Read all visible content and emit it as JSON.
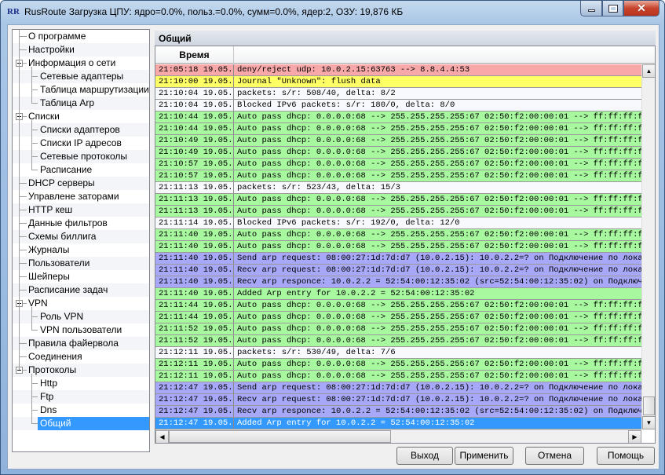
{
  "window": {
    "icon_text": "RR",
    "title": "RusRoute   Загрузка ЦПУ: ядро=0.0%, польз.=0.0%, сумм=0.0%, ядер:2,  ОЗУ: 19,876 КБ"
  },
  "tree": [
    {
      "label": "О программе",
      "level": 0
    },
    {
      "label": "Настройки",
      "level": 0
    },
    {
      "label": "Информация о сети",
      "level": 0,
      "expanded": true
    },
    {
      "label": "Сетевые адаптеры",
      "level": 1
    },
    {
      "label": "Таблица маршрутизации",
      "level": 1
    },
    {
      "label": "Таблица Arp",
      "level": 1,
      "last": true
    },
    {
      "label": "Списки",
      "level": 0,
      "expanded": true
    },
    {
      "label": "Списки адаптеров",
      "level": 1
    },
    {
      "label": "Списки IP адресов",
      "level": 1
    },
    {
      "label": "Сетевые протоколы",
      "level": 1
    },
    {
      "label": "Расписание",
      "level": 1,
      "last": true
    },
    {
      "label": "DHCP серверы",
      "level": 0
    },
    {
      "label": "Управлене заторами",
      "level": 0
    },
    {
      "label": "HTTP кеш",
      "level": 0
    },
    {
      "label": "Данные фильтров",
      "level": 0
    },
    {
      "label": "Схемы биллига",
      "level": 0
    },
    {
      "label": "Журналы",
      "level": 0
    },
    {
      "label": "Пользователи",
      "level": 0
    },
    {
      "label": "Шейперы",
      "level": 0
    },
    {
      "label": "Расписание задач",
      "level": 0
    },
    {
      "label": "VPN",
      "level": 0,
      "expanded": true
    },
    {
      "label": "Роль VPN",
      "level": 1
    },
    {
      "label": "VPN пользователи",
      "level": 1,
      "last": true
    },
    {
      "label": "Правила файервола",
      "level": 0
    },
    {
      "label": "Соединения",
      "level": 0
    },
    {
      "label": "Протоколы",
      "level": 0,
      "expanded": true,
      "last": true
    },
    {
      "label": "Http",
      "level": 1
    },
    {
      "label": "Ftp",
      "level": 1
    },
    {
      "label": "Dns",
      "level": 1
    },
    {
      "label": "Общий",
      "level": 1,
      "last": true,
      "selected": true
    }
  ],
  "panel": {
    "title": "Общий",
    "column_time": "Время"
  },
  "colors": {
    "red": "#f8a8a8",
    "yellow": "#ffff66",
    "white": "#f7f9fc",
    "green": "#a8f8a0",
    "blue": "#a8a8f8",
    "selected": "#3399ff"
  },
  "log": [
    {
      "time": "21:05:18 19.05.",
      "msg": "deny/reject udp: 10.0.2.15:63763 --> 8.8.4.4:53",
      "color": "red"
    },
    {
      "time": "21:10:00 19.05.",
      "msg": "Journal \"Unknown\": flush data",
      "color": "yellow"
    },
    {
      "time": "21:10:04 19.05.",
      "msg": "packets: s/r: 508/40, delta: 8/2",
      "color": "white"
    },
    {
      "time": "21:10:04 19.05.",
      "msg": "Blocked IPv6 packets: s/r: 180/0, delta: 8/0",
      "color": "white"
    },
    {
      "time": "21:10:44 19.05.",
      "msg": "Auto pass dhcp: 0.0.0.0:68 --> 255.255.255.255:67 02:50:f2:00:00:01 --> ff:ff:ff:ff:ff",
      "color": "green"
    },
    {
      "time": "21:10:44 19.05.",
      "msg": "Auto pass dhcp: 0.0.0.0:68 --> 255.255.255.255:67 02:50:f2:00:00:01 --> ff:ff:ff:ff:ff",
      "color": "green"
    },
    {
      "time": "21:10:49 19.05.",
      "msg": "Auto pass dhcp: 0.0.0.0:68 --> 255.255.255.255:67 02:50:f2:00:00:01 --> ff:ff:ff:ff:ff",
      "color": "green"
    },
    {
      "time": "21:10:49 19.05.",
      "msg": "Auto pass dhcp: 0.0.0.0:68 --> 255.255.255.255:67 02:50:f2:00:00:01 --> ff:ff:ff:ff:ff",
      "color": "green"
    },
    {
      "time": "21:10:57 19.05.",
      "msg": "Auto pass dhcp: 0.0.0.0:68 --> 255.255.255.255:67 02:50:f2:00:00:01 --> ff:ff:ff:ff:ff",
      "color": "green"
    },
    {
      "time": "21:10:57 19.05.",
      "msg": "Auto pass dhcp: 0.0.0.0:68 --> 255.255.255.255:67 02:50:f2:00:00:01 --> ff:ff:ff:ff:ff",
      "color": "green"
    },
    {
      "time": "21:11:13 19.05.",
      "msg": "packets: s/r: 523/43, delta: 15/3",
      "color": "white"
    },
    {
      "time": "21:11:13 19.05.",
      "msg": "Auto pass dhcp: 0.0.0.0:68 --> 255.255.255.255:67 02:50:f2:00:00:01 --> ff:ff:ff:ff:ff",
      "color": "green"
    },
    {
      "time": "21:11:13 19.05.",
      "msg": "Auto pass dhcp: 0.0.0.0:68 --> 255.255.255.255:67 02:50:f2:00:00:01 --> ff:ff:ff:ff:ff",
      "color": "green"
    },
    {
      "time": "21:11:14 19.05.",
      "msg": "Blocked IPv6 packets: s/r: 192/0, delta: 12/0",
      "color": "white"
    },
    {
      "time": "21:11:40 19.05.",
      "msg": "Auto pass dhcp: 0.0.0.0:68 --> 255.255.255.255:67 02:50:f2:00:00:01 --> ff:ff:ff:ff:ff",
      "color": "green"
    },
    {
      "time": "21:11:40 19.05.",
      "msg": "Auto pass dhcp: 0.0.0.0:68 --> 255.255.255.255:67 02:50:f2:00:00:01 --> ff:ff:ff:ff:ff",
      "color": "green"
    },
    {
      "time": "21:11:40 19.05.",
      "msg": "Send arp request: 08:00:27:1d:7d:d7 (10.0.2.15): 10.0.2.2=? on Подключение по локально",
      "color": "blue"
    },
    {
      "time": "21:11:40 19.05.",
      "msg": "Recv arp request: 08:00:27:1d:7d:d7 (10.0.2.15): 10.0.2.2=? on Подключение по локально",
      "color": "blue"
    },
    {
      "time": "21:11:40 19.05.",
      "msg": "Recv arp responce: 10.0.2.2 = 52:54:00:12:35:02 (src=52:54:00:12:35:02) on Подключение",
      "color": "blue"
    },
    {
      "time": "21:11:40 19.05.",
      "msg": "Added Arp entry for 10.0.2.2 = 52:54:00:12:35:02",
      "color": "green"
    },
    {
      "time": "21:11:44 19.05.",
      "msg": "Auto pass dhcp: 0.0.0.0:68 --> 255.255.255.255:67 02:50:f2:00:00:01 --> ff:ff:ff:ff:ff",
      "color": "green"
    },
    {
      "time": "21:11:44 19.05.",
      "msg": "Auto pass dhcp: 0.0.0.0:68 --> 255.255.255.255:67 02:50:f2:00:00:01 --> ff:ff:ff:ff:ff",
      "color": "green"
    },
    {
      "time": "21:11:52 19.05.",
      "msg": "Auto pass dhcp: 0.0.0.0:68 --> 255.255.255.255:67 02:50:f2:00:00:01 --> ff:ff:ff:ff:ff",
      "color": "green"
    },
    {
      "time": "21:11:52 19.05.",
      "msg": "Auto pass dhcp: 0.0.0.0:68 --> 255.255.255.255:67 02:50:f2:00:00:01 --> ff:ff:ff:ff:ff",
      "color": "green"
    },
    {
      "time": "21:12:11 19.05.",
      "msg": "packets: s/r: 530/49, delta: 7/6",
      "color": "white"
    },
    {
      "time": "21:12:11 19.05.",
      "msg": "Auto pass dhcp: 0.0.0.0:68 --> 255.255.255.255:67 02:50:f2:00:00:01 --> ff:ff:ff:ff:ff",
      "color": "green"
    },
    {
      "time": "21:12:11 19.05.",
      "msg": "Auto pass dhcp: 0.0.0.0:68 --> 255.255.255.255:67 02:50:f2:00:00:01 --> ff:ff:ff:ff:ff",
      "color": "green"
    },
    {
      "time": "21:12:47 19.05.",
      "msg": "Send arp request: 08:00:27:1d:7d:d7 (10.0.2.15): 10.0.2.2=? on Подключение по локально",
      "color": "blue"
    },
    {
      "time": "21:12:47 19.05.",
      "msg": "Recv arp request: 08:00:27:1d:7d:d7 (10.0.2.15): 10.0.2.2=? on Подключение по локально",
      "color": "blue"
    },
    {
      "time": "21:12:47 19.05.",
      "msg": "Recv arp responce: 10.0.2.2 = 52:54:00:12:35:02 (src=52:54:00:12:35:02) on Подключение",
      "color": "blue"
    },
    {
      "time": "21:12:47 19.05.",
      "msg": "Added Arp entry for 10.0.2.2 = 52:54:00:12:35:02",
      "color": "selected"
    }
  ],
  "buttons": {
    "exit": "Выход",
    "apply": "Применить",
    "cancel": "Отмена",
    "help": "Помощь"
  }
}
